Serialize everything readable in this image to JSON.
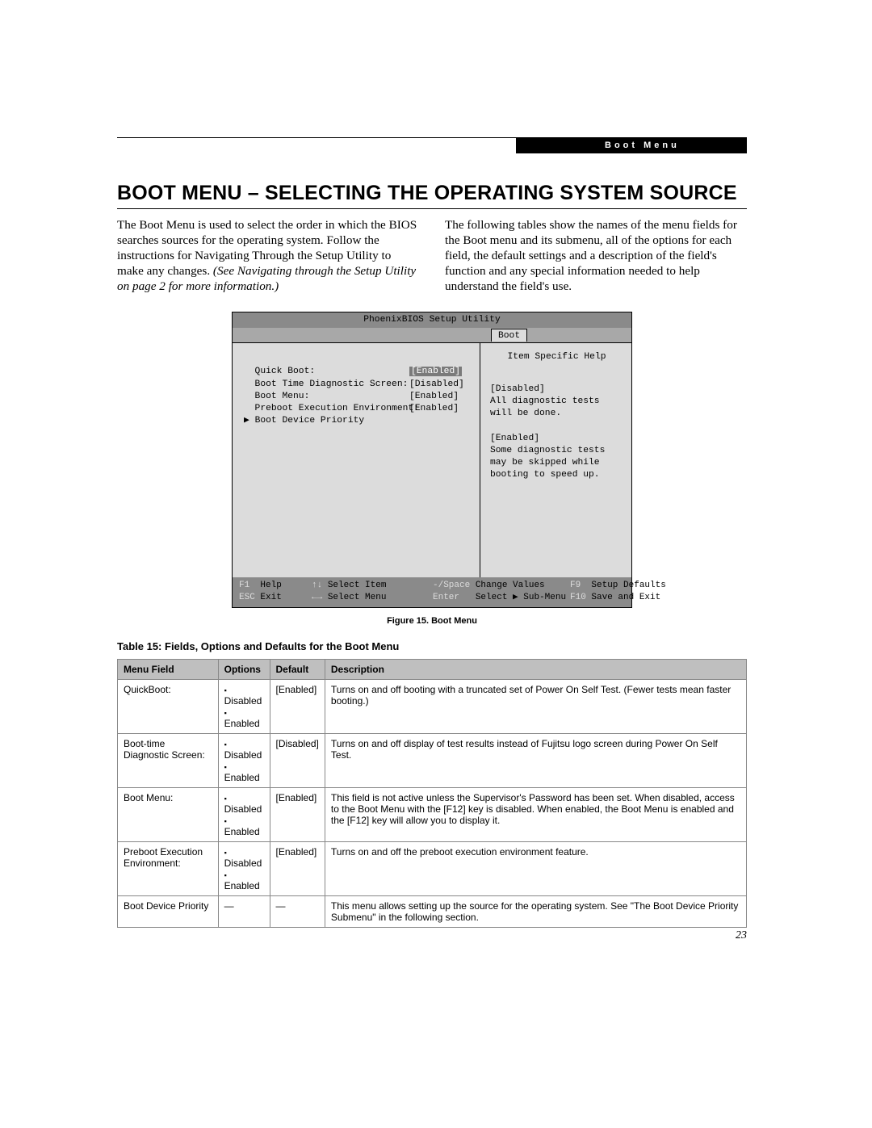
{
  "header": {
    "corner_tag": "Boot Menu",
    "heading": "BOOT MENU – SELECTING THE OPERATING SYSTEM SOURCE"
  },
  "intro": {
    "left_plain": "The Boot Menu is used to select the order in which the BIOS searches sources for the operating system. Follow the instructions for Navigating Through the Setup Utility to make any changes. ",
    "left_italic": "(See Navigating through the Setup Utility on page 2 for more information.)",
    "right": "The following tables show the names of the menu fields for the Boot menu and its submenu, all of the options for each field, the default settings and a description of the field's function and any special information needed to help understand the field's use."
  },
  "bios": {
    "title": "PhoenixBIOS Setup Utility",
    "tab": "Boot",
    "rows": [
      {
        "label": "Quick Boot:",
        "value": "[Enabled]",
        "selected": true,
        "arrow": false
      },
      {
        "label": "Boot Time Diagnostic Screen:",
        "value": "[Disabled]",
        "selected": false,
        "arrow": false
      },
      {
        "label": "Boot Menu:",
        "value": "[Enabled]",
        "selected": false,
        "arrow": false
      },
      {
        "label": "Preboot Execution Environment:",
        "value": "[Enabled]",
        "selected": false,
        "arrow": false
      },
      {
        "label": "Boot Device Priority",
        "value": "",
        "selected": false,
        "arrow": true
      }
    ],
    "help_title": "Item Specific Help",
    "help_body": "[Disabled]\nAll diagnostic tests will be done.\n\n[Enabled]\nSome diagnostic tests may be skipped while booting to speed up.",
    "footer": {
      "f1": "F1",
      "f1t": "Help",
      "ud": "↑↓",
      "udt": "Select Item",
      "ms": "-/Space",
      "mst": "Change Values",
      "f9": "F9",
      "f9t": "Setup Defaults",
      "esc": "ESC",
      "esct": "Exit",
      "lr": "←→",
      "lrt": "Select Menu",
      "ent": "Enter",
      "entt": "Select ▶ Sub-Menu",
      "f10": "F10",
      "f10t": "Save and Exit"
    }
  },
  "figure_caption": "Figure 15.  Boot Menu",
  "table_title": "Table 15: Fields, Options and Defaults for the Boot Menu",
  "table": {
    "headers": [
      "Menu Field",
      "Options",
      "Default",
      "Description"
    ],
    "rows": [
      {
        "field": "QuickBoot:",
        "options": [
          "Disabled",
          "Enabled"
        ],
        "default": "[Enabled]",
        "desc": "Turns on and off booting with a truncated set of Power On Self Test. (Fewer tests mean faster booting.)"
      },
      {
        "field": "Boot-time Diagnostic Screen:",
        "options": [
          "Disabled",
          "Enabled"
        ],
        "default": "[Disabled]",
        "desc": "Turns on and off display of test results instead of Fujitsu logo screen during Power On Self Test."
      },
      {
        "field": "Boot Menu:",
        "options": [
          "Disabled",
          "Enabled"
        ],
        "default": "[Enabled]",
        "desc": "This field is not active unless the Supervisor's Password has been set. When disabled, access to the Boot Menu with the [F12] key is disabled. When enabled, the Boot Menu is enabled and the [F12] key will allow you to display it."
      },
      {
        "field": "Preboot Execution Environment:",
        "options": [
          "Disabled",
          "Enabled"
        ],
        "default": "[Enabled]",
        "desc": "Turns on and off the preboot execution environment feature."
      },
      {
        "field": "Boot Device Priority",
        "options": [],
        "default": "—",
        "desc": "This menu allows setting up the source for the operating system. See \"The Boot Device Priority Submenu\" in the following section."
      }
    ]
  },
  "page_number": "23"
}
